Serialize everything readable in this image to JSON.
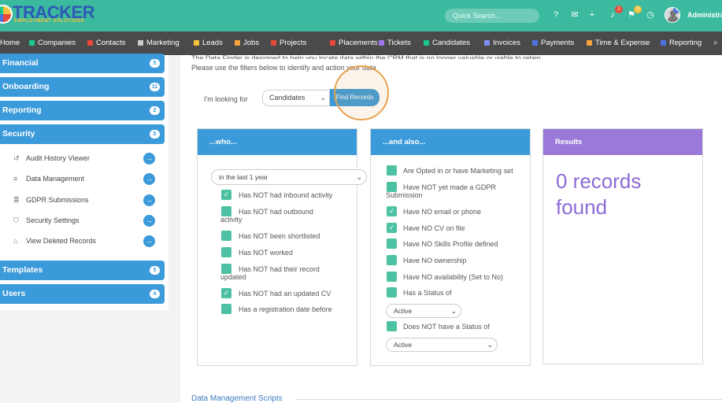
{
  "app": {
    "logo_text": "TRACKER",
    "logo_subtext": "EMPLOYMENT SOLUTIONS"
  },
  "header": {
    "search_placeholder": "Quick Search...",
    "icons": [
      {
        "name": "help-icon",
        "glyph": "?"
      },
      {
        "name": "chat-icon",
        "glyph": "✉"
      },
      {
        "name": "add-icon",
        "glyph": "+"
      },
      {
        "name": "bell-icon",
        "glyph": "♪",
        "badge": "2",
        "badge_color": "#e74a3b"
      },
      {
        "name": "flag-icon",
        "glyph": "⚑",
        "badge": "3",
        "badge_color": "#f6c23e"
      },
      {
        "name": "history-icon",
        "glyph": "◷"
      }
    ],
    "avatar_badge": "2",
    "user_name": "Administrator"
  },
  "nav": {
    "items": [
      {
        "label": "Home",
        "color": "transparent"
      },
      {
        "label": "Companies",
        "color": "#1cc88a"
      },
      {
        "label": "Contacts",
        "color": "#e74a3b"
      },
      {
        "label": "Marketing",
        "color": "#cccccc"
      },
      {
        "label": "Leads",
        "color": "#f6c23e"
      },
      {
        "label": "Jobs",
        "color": "#f6a23e"
      },
      {
        "label": "Projects",
        "color": "#e74a3b"
      },
      {
        "label": "Placements",
        "color": "#e74a3b"
      },
      {
        "label": "Tickets",
        "color": "#a076e8"
      },
      {
        "label": "Candidates",
        "color": "#1cc88a"
      },
      {
        "label": "Invoices",
        "color": "#7c8ef0"
      },
      {
        "label": "Payments",
        "color": "#4e73df"
      },
      {
        "label": "Time & Expense",
        "color": "#f6a23e"
      },
      {
        "label": "Reporting",
        "color": "#4e73df"
      }
    ]
  },
  "sidebar": {
    "sections": [
      {
        "label": "Financial",
        "count": "5"
      },
      {
        "label": "Onboarding",
        "count": "11"
      },
      {
        "label": "Reporting",
        "count": "2"
      },
      {
        "label": "Security",
        "count": "5"
      },
      {
        "label": "Templates",
        "count": "5"
      },
      {
        "label": "Users",
        "count": "4"
      }
    ],
    "security_items": [
      {
        "label": "Audit History Viewer",
        "icon": "history-icon",
        "glyph": "↺"
      },
      {
        "label": "Data Management",
        "icon": "database-icon",
        "glyph": "≡"
      },
      {
        "label": "GDPR Submissions",
        "icon": "gdpr-icon",
        "glyph": "≣"
      },
      {
        "label": "Security Settings",
        "icon": "shield-icon",
        "glyph": "⛉"
      },
      {
        "label": "View Deleted Records",
        "icon": "trash-icon",
        "glyph": "⌂"
      }
    ]
  },
  "main": {
    "intro_line1": "The Data Finder is designed to help you locate data within the CRM that is no longer valuable or viable to retain",
    "intro_line2": "Please use the filters below to identify and action your data",
    "looking_for_label": "I'm looking for",
    "record_type_value": "Candidates",
    "find_button_label": "Find Records"
  },
  "panels": {
    "who": {
      "title": "...who...",
      "header_color": "#3b9ad9",
      "period_value": "in the last 1 year",
      "items": [
        {
          "label_lines": [
            "Has NOT had inbound activity"
          ],
          "checked": true
        },
        {
          "label_lines": [
            "Has NOT had outbound",
            "activity"
          ],
          "checked": false
        },
        {
          "label_lines": [
            "Has NOT been shortlisted"
          ],
          "checked": false
        },
        {
          "label_lines": [
            "Has NOT worked"
          ],
          "checked": false
        },
        {
          "label_lines": [
            "Has NOT had their record",
            "updated"
          ],
          "checked": false
        },
        {
          "label_lines": [
            "Has NOT had an updated CV"
          ],
          "checked": true
        },
        {
          "label_lines": [
            "Has a registration date before"
          ],
          "checked": false
        }
      ]
    },
    "also": {
      "title": "...and also...",
      "header_color": "#3b9ad9",
      "items": [
        {
          "label_lines": [
            "Are Opted in or have Marketing set"
          ],
          "checked": false
        },
        {
          "label_lines": [
            "Have NOT yet made a GDPR",
            "Submission"
          ],
          "checked": false
        },
        {
          "label_lines": [
            "Have NO email or phone"
          ],
          "checked": true
        },
        {
          "label_lines": [
            "Have NO CV on file"
          ],
          "checked": true
        },
        {
          "label_lines": [
            "Have NO Skills Profile defined"
          ],
          "checked": false
        },
        {
          "label_lines": [
            "Have NO ownership"
          ],
          "checked": false
        },
        {
          "label_lines": [
            "Have NO availability (Set to No)"
          ],
          "checked": false
        },
        {
          "label_lines": [
            "Has a Status of"
          ],
          "checked": false
        },
        {
          "label_lines": [
            "Does NOT have a Status of"
          ],
          "checked": false
        }
      ],
      "status_value": "Active",
      "not_status_value": "Active"
    },
    "results": {
      "title": "Results",
      "header_color": "#9a79d9",
      "text": "0 records found"
    }
  },
  "scripts": {
    "title": "Data Management Scripts"
  }
}
